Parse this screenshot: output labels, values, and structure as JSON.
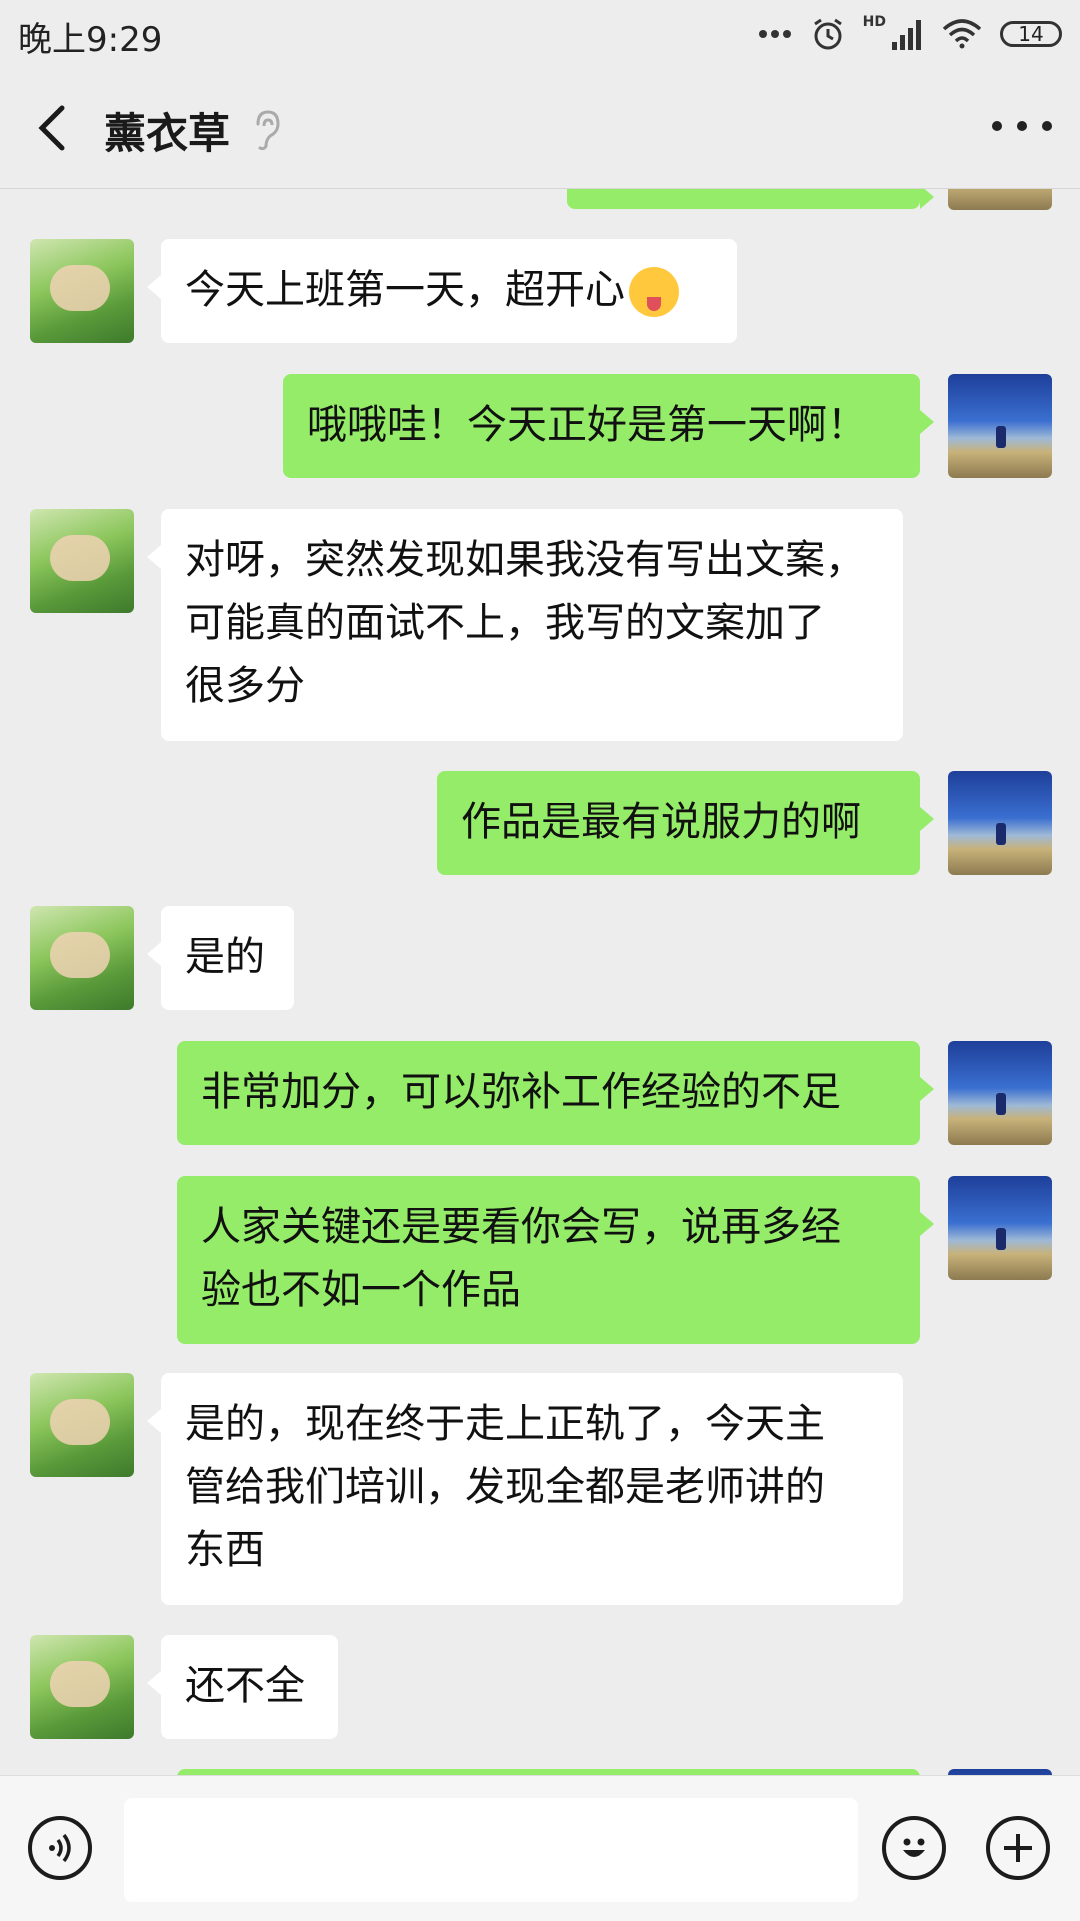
{
  "status_bar": {
    "time": "晚上9:29",
    "network": "HD",
    "battery": "14"
  },
  "header": {
    "title": "薰衣草"
  },
  "messages": [
    {
      "side": "left",
      "lines": [
        "今天上班第一天，超开心"
      ],
      "emoji": "squinting-tongue-emoji"
    },
    {
      "side": "right",
      "lines": [
        "哦哦哇！今天正好是第一天啊！"
      ]
    },
    {
      "side": "left",
      "lines": [
        "对呀，突然发现如果我没有写出文案，",
        "可能真的面试不上，我写的文案加了",
        "很多分"
      ]
    },
    {
      "side": "right",
      "lines": [
        "作品是最有说服力的啊"
      ]
    },
    {
      "side": "left",
      "lines": [
        "是的"
      ]
    },
    {
      "side": "right",
      "lines": [
        "非常加分，可以弥补工作经验的不足"
      ]
    },
    {
      "side": "right",
      "lines": [
        "人家关键还是要看你会写，说再多经",
        "验也不如一个作品"
      ]
    },
    {
      "side": "left",
      "lines": [
        "是的，现在终于走上正轨了，今天主",
        "管给我们培训，发现全都是老师讲的",
        "东西"
      ]
    },
    {
      "side": "left",
      "lines": [
        "还不全"
      ]
    }
  ],
  "input": {
    "placeholder": ""
  },
  "colors": {
    "background": "#ededed",
    "bubble_self": "#95ec69",
    "bubble_other": "#ffffff"
  },
  "icons": {
    "back": "chevron-left-icon",
    "ear": "ear-icon",
    "more": "more-icon",
    "voice": "voice-icon",
    "emoji": "emoji-icon",
    "plus": "plus-icon"
  }
}
